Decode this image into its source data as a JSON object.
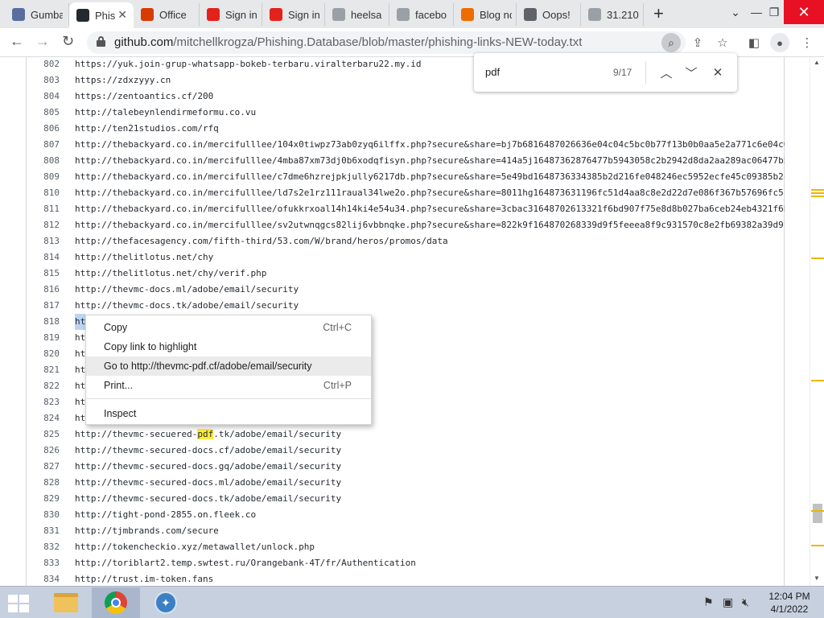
{
  "browser": {
    "tabs": [
      {
        "title": "Gumba",
        "icon": "avatar-icon",
        "color": "#5a6e9e"
      },
      {
        "title": "Phis",
        "icon": "github-icon",
        "color": "#24292f",
        "active": true
      },
      {
        "title": "Office",
        "icon": "office-icon",
        "color": "#d83b01"
      },
      {
        "title": "Sign in",
        "icon": "adobe-icon",
        "color": "#e3221b"
      },
      {
        "title": "Sign in",
        "icon": "adobe-icon",
        "color": "#e3221b"
      },
      {
        "title": "heelsa",
        "icon": "globe-icon",
        "color": "#9aa0a6"
      },
      {
        "title": "facebo",
        "icon": "globe-icon",
        "color": "#9aa0a6"
      },
      {
        "title": "Blog no",
        "icon": "blogger-icon",
        "color": "#ef6c00"
      },
      {
        "title": "Oops! ",
        "icon": "globe-icon",
        "color": "#5f6368"
      },
      {
        "title": "31.210",
        "icon": "globe-icon",
        "color": "#9aa0a6"
      }
    ],
    "tab_close_glyph": "✕",
    "new_tab_glyph": "+",
    "url_host": "github.com",
    "url_path": "/mitchellkrogza/Phishing.Database/blob/master/phishing-links-NEW-today.txt"
  },
  "find": {
    "query": "pdf",
    "count": "9/17"
  },
  "file": {
    "lines": [
      {
        "n": "802",
        "text": "https://yuk.join-grup-whatsapp-bokeb-terbaru.viralterbaru22.my.id"
      },
      {
        "n": "803",
        "text": "https://zdxzyyy.cn"
      },
      {
        "n": "804",
        "text": "https://zentoantics.cf/200"
      },
      {
        "n": "805",
        "text": "http://talebeynlendirmeformu.co.vu"
      },
      {
        "n": "806",
        "text": "http://ten21studios.com/rfq"
      },
      {
        "n": "807",
        "text": "http://thebackyard.co.in/mercifulllee/104x0tiwpz73ab0zyq6ilffx.php?secure&share=bj7b6816487026636e04c04c5bc0b77f13b0b0aa5e2a771c6e04c0"
      },
      {
        "n": "808",
        "text": "http://thebackyard.co.in/mercifulllee/4mba87xm73dj0b6xodqfisyn.php?secure&share=414a5j16487362876477b5943058c2b2942d8da2aa289ac06477b5"
      },
      {
        "n": "809",
        "text": "http://thebackyard.co.in/mercifulllee/c7dme6hzrejpkjully6217db.php?secure&share=5e49bd1648736334385b2d216fe048246ec5952ecfe45c09385b2c"
      },
      {
        "n": "810",
        "text": "http://thebackyard.co.in/mercifulllee/ld7s2e1rz111raual34lwe2o.php?secure&share=8011hg164873631196fc51d4aa8c8e2d22d7e086f367b57696fc51"
      },
      {
        "n": "811",
        "text": "http://thebackyard.co.in/mercifulllee/ofukkrxoal14h14ki4e54u34.php?secure&share=3cbac31648702613321f6bd907f75e8d8b027ba6ceb24eb4321f6b"
      },
      {
        "n": "812",
        "text": "http://thebackyard.co.in/mercifulllee/sv2utwnqgcs82lij6vbbnqke.php?secure&share=822k9f164870268339d9f5feeea8f9c931570c8e2fb69382a39d9f5"
      },
      {
        "n": "813",
        "text": "http://thefacesagency.com/fifth-third/53.com/W/brand/heros/promos/data"
      },
      {
        "n": "814",
        "text": "http://thelitlotus.net/chy"
      },
      {
        "n": "815",
        "text": "http://thelitlotus.net/chy/verif.php"
      },
      {
        "n": "816",
        "text": "http://thevmc-docs.ml/adobe/email/security"
      },
      {
        "n": "817",
        "text": "http://thevmc-docs.tk/adobe/email/security"
      },
      {
        "n": "818",
        "text": "ht"
      },
      {
        "n": "819",
        "text": "ht"
      },
      {
        "n": "820",
        "text": "ht"
      },
      {
        "n": "821",
        "text": "ht"
      },
      {
        "n": "822",
        "text": "ht"
      },
      {
        "n": "823",
        "text": "ht"
      },
      {
        "n": "824",
        "text": "ht"
      },
      {
        "n": "825",
        "text": "http://thevmc-secuered-pdf.tk/adobe/email/security",
        "pre": "http://thevmc-secuered-",
        "mark": "pdf",
        "post": ".tk/adobe/email/security"
      },
      {
        "n": "826",
        "text": "http://thevmc-secured-docs.cf/adobe/email/security"
      },
      {
        "n": "827",
        "text": "http://thevmc-secured-docs.gq/adobe/email/security"
      },
      {
        "n": "828",
        "text": "http://thevmc-secured-docs.ml/adobe/email/security"
      },
      {
        "n": "829",
        "text": "http://thevmc-secured-docs.tk/adobe/email/security"
      },
      {
        "n": "830",
        "text": "http://tight-pond-2855.on.fleek.co"
      },
      {
        "n": "831",
        "text": "http://tjmbrands.com/secure"
      },
      {
        "n": "832",
        "text": "http://tokencheckio.xyz/metawallet/unlock.php"
      },
      {
        "n": "833",
        "text": "http://toriblart2.temp.swtest.ru/Orangebank-4T/fr/Authentication"
      },
      {
        "n": "834",
        "text": "http://trust.im-token.fans"
      }
    ]
  },
  "context_menu": {
    "items": [
      {
        "label": "Copy",
        "shortcut": "Ctrl+C"
      },
      {
        "label": "Copy link to highlight",
        "shortcut": ""
      },
      {
        "label": "Go to http://thevmc-pdf.cf/adobe/email/security",
        "shortcut": "",
        "highlighted": true
      },
      {
        "label": "Print...",
        "shortcut": "Ctrl+P"
      },
      {
        "label": "Inspect",
        "shortcut": ""
      }
    ]
  },
  "taskbar": {
    "time": "12:04 PM",
    "date": "4/1/2022"
  },
  "colors": {
    "find_highlight": "#ffeb3b",
    "selection": "#bcd5f3",
    "scroll_marker": "#e8b800",
    "close_red": "#e81123"
  }
}
